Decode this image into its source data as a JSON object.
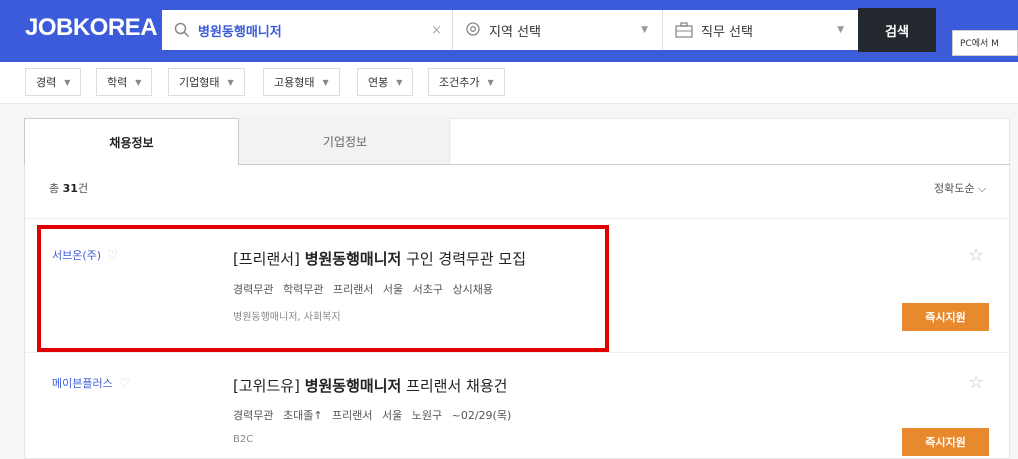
{
  "header": {
    "logo": "JOBKOREA",
    "search_value": "병원동행매니저",
    "clear_icon": "×",
    "region_label": "지역 선택",
    "job_label": "직무 선택",
    "search_button": "검색",
    "pc_button": "PC에서 M"
  },
  "filters": [
    "경력",
    "학력",
    "기업형태",
    "고용형태",
    "연봉",
    "조건추가"
  ],
  "tabs": {
    "active": "채용정보",
    "inactive": "기업정보"
  },
  "summary": {
    "total_prefix": "총 ",
    "total_count": "31",
    "total_suffix": "건",
    "sort_label": "정확도순"
  },
  "jobs": [
    {
      "company": "서브온(주)",
      "title_prefix": "[프리랜서] ",
      "title_bold": "병원동행매니저",
      "title_suffix": " 구인 경력무관 모집",
      "conditions": "경력무관 학력무관 프리랜서 서울 서초구 상시채용",
      "tags": "병원동행매니저, 사회복지",
      "apply_label": "즉시지원"
    },
    {
      "company": "메이븐플러스",
      "title_prefix": "[고위드유] ",
      "title_bold": "병원동행매니저",
      "title_suffix": " 프리랜서 채용건",
      "conditions": "경력무관 초대졸↑ 프리랜서 서울 노원구 ~02/29(목)",
      "tags": "B2C",
      "apply_label": "즉시지원"
    }
  ],
  "colors": {
    "brand": "#3b5bdb",
    "apply": "#e8892e",
    "highlight": "#e00000"
  }
}
